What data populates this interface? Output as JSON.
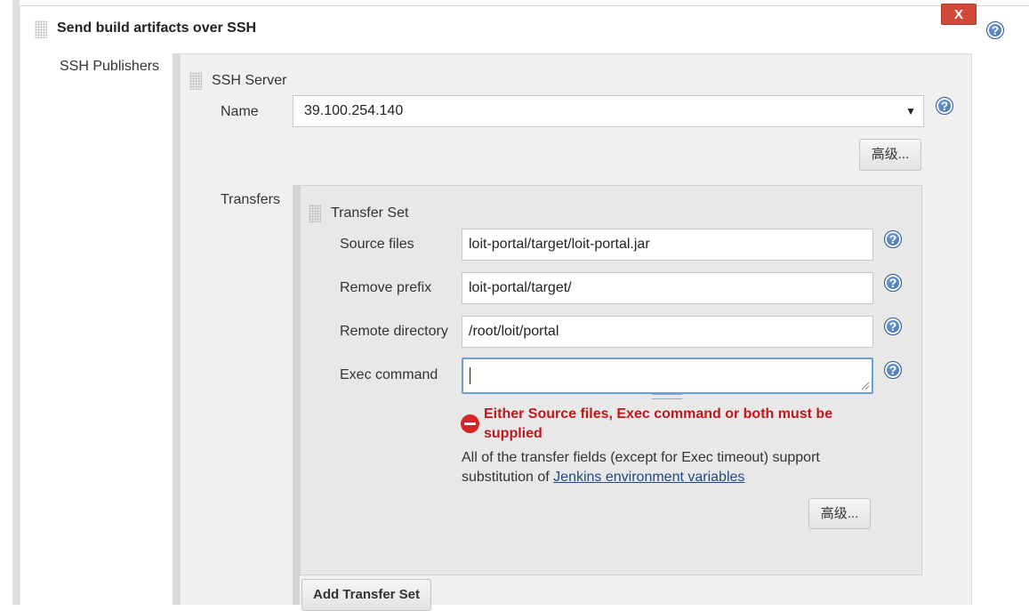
{
  "header": {
    "title": "Send build artifacts over SSH",
    "delete_label": "X",
    "help_symbol": "?"
  },
  "ssh_publishers": {
    "label": "SSH Publishers",
    "ssh_server": {
      "title": "SSH Server",
      "name_label": "Name",
      "name_value": "39.100.254.140",
      "advanced_label": "高级..."
    },
    "transfers": {
      "label": "Transfers",
      "transfer_set": {
        "title": "Transfer Set",
        "source_files_label": "Source files",
        "source_files_value": "loit-portal/target/loit-portal.jar",
        "remove_prefix_label": "Remove prefix",
        "remove_prefix_value": "loit-portal/target/",
        "remote_directory_label": "Remote directory",
        "remote_directory_value": "/root/loit/portal",
        "exec_command_label": "Exec command",
        "exec_command_value": "",
        "error_line1": "Either Source files, Exec command or both must be",
        "error_line2": "supplied",
        "info_line1": "All of the transfer fields (except for Exec timeout) support",
        "info_line2_prefix": "substitution of ",
        "info_link": "Jenkins environment variables",
        "advanced_label": "高级..."
      },
      "add_transfer_set_label": "Add Transfer Set"
    }
  },
  "colors": {
    "delete_button": "#d24939",
    "error_text": "#c4151c",
    "link": "#204a87",
    "focus_border": "#6a9fd8"
  },
  "icons": [
    "drag-handle-icon",
    "help-icon",
    "error-icon",
    "dropdown-arrow-icon"
  ]
}
